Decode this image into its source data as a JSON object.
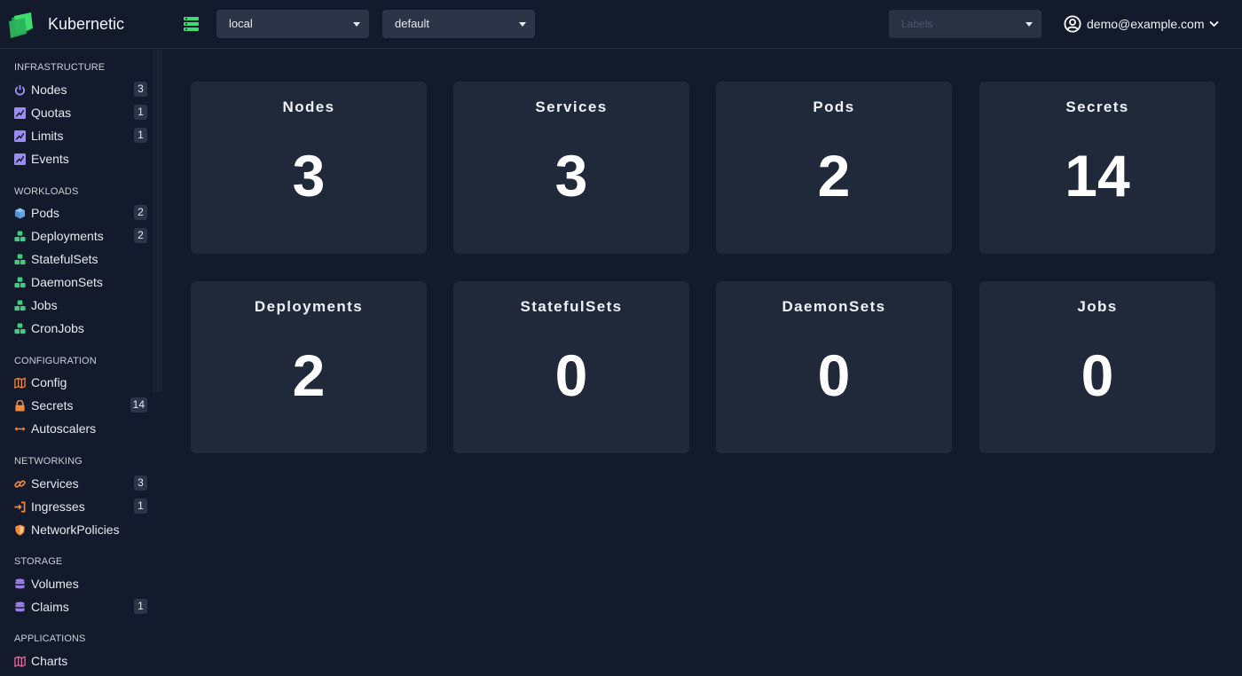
{
  "header": {
    "app_title": "Kubernetic",
    "context": "local",
    "namespace": "default",
    "labels_placeholder": "Labels",
    "user_email": "demo@example.com"
  },
  "sidebar": {
    "sections": [
      {
        "title": "INFRASTRUCTURE",
        "items": [
          {
            "label": "Nodes",
            "count": "3",
            "icon": "power-icon"
          },
          {
            "label": "Quotas",
            "count": "1",
            "icon": "chart-icon"
          },
          {
            "label": "Limits",
            "count": "1",
            "icon": "chart-icon"
          },
          {
            "label": "Events",
            "count": "",
            "icon": "chart-icon"
          }
        ]
      },
      {
        "title": "WORKLOADS",
        "items": [
          {
            "label": "Pods",
            "count": "2",
            "icon": "cube-icon"
          },
          {
            "label": "Deployments",
            "count": "2",
            "icon": "cubes-icon"
          },
          {
            "label": "StatefulSets",
            "count": "",
            "icon": "cubes-icon"
          },
          {
            "label": "DaemonSets",
            "count": "",
            "icon": "cubes-icon"
          },
          {
            "label": "Jobs",
            "count": "",
            "icon": "cubes-icon"
          },
          {
            "label": "CronJobs",
            "count": "",
            "icon": "cubes-icon"
          }
        ]
      },
      {
        "title": "CONFIGURATION",
        "items": [
          {
            "label": "Config",
            "count": "",
            "icon": "map-icon"
          },
          {
            "label": "Secrets",
            "count": "14",
            "icon": "lock-icon"
          },
          {
            "label": "Autoscalers",
            "count": "",
            "icon": "arrows-icon"
          }
        ]
      },
      {
        "title": "NETWORKING",
        "items": [
          {
            "label": "Services",
            "count": "3",
            "icon": "link-icon"
          },
          {
            "label": "Ingresses",
            "count": "1",
            "icon": "sign-in-icon"
          },
          {
            "label": "NetworkPolicies",
            "count": "",
            "icon": "shield-icon"
          }
        ]
      },
      {
        "title": "STORAGE",
        "items": [
          {
            "label": "Volumes",
            "count": "",
            "icon": "database-icon"
          },
          {
            "label": "Claims",
            "count": "1",
            "icon": "database-icon"
          }
        ]
      },
      {
        "title": "APPLICATIONS",
        "items": [
          {
            "label": "Charts",
            "count": "",
            "icon": "map-icon"
          }
        ]
      }
    ]
  },
  "cards": [
    {
      "title": "Nodes",
      "value": "3"
    },
    {
      "title": "Services",
      "value": "3"
    },
    {
      "title": "Pods",
      "value": "2"
    },
    {
      "title": "Secrets",
      "value": "14"
    },
    {
      "title": "Deployments",
      "value": "2"
    },
    {
      "title": "StatefulSets",
      "value": "0"
    },
    {
      "title": "DaemonSets",
      "value": "0"
    },
    {
      "title": "Jobs",
      "value": "0"
    }
  ],
  "colors": {
    "background": "#131a2b",
    "card": "#20293a",
    "select": "#2c3447",
    "brand_green": "#3ddc6f",
    "infra_purple": "#9b8cf0",
    "workload_green": "#3fcf7c",
    "workload_blue": "#5ea6e8",
    "config_orange": "#f0883e",
    "storage_purple": "#9b7de8",
    "apps_pink": "#e36aa2"
  }
}
